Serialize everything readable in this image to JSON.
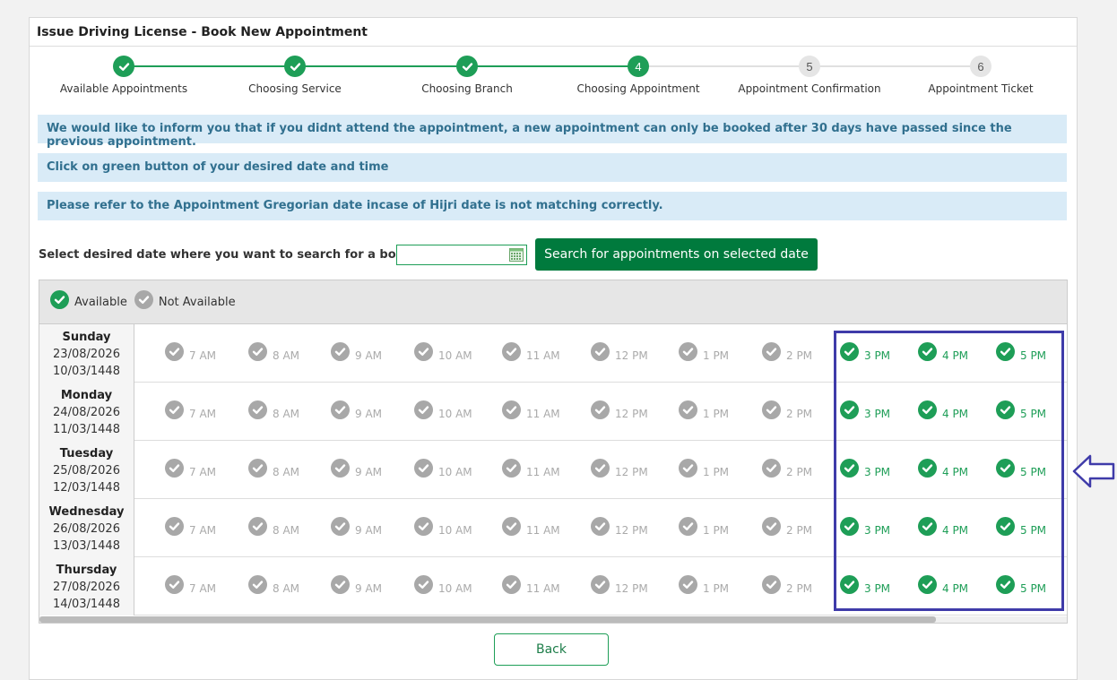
{
  "panel": {
    "title": "Issue Driving License - Book New Appointment"
  },
  "steps": [
    {
      "number": "1",
      "label": "Available Appointments",
      "state": "done"
    },
    {
      "number": "2",
      "label": "Choosing Service",
      "state": "done"
    },
    {
      "number": "3",
      "label": "Choosing Branch",
      "state": "done"
    },
    {
      "number": "4",
      "label": "Choosing Appointment",
      "state": "current"
    },
    {
      "number": "5",
      "label": "Appointment Confirmation",
      "state": "todo"
    },
    {
      "number": "6",
      "label": "Appointment Ticket",
      "state": "todo"
    }
  ],
  "notices": [
    "We would like to inform you that if you didnt attend the appointment, a new appointment can only be booked after 30 days have passed since the previous appointment.",
    "Click on green button of your desired date and time",
    "Please refer to the Appointment Gregorian date incase of Hijri date is not matching correctly."
  ],
  "search": {
    "label": "Select desired date where you want to search for a booking  :",
    "date_value": "",
    "button_label": "Search for appointments on selected date"
  },
  "legend": {
    "available": "Available",
    "not_available": "Not Available"
  },
  "time_slots": [
    "7 AM",
    "8 AM",
    "9 AM",
    "10 AM",
    "11 AM",
    "12 PM",
    "1 PM",
    "2 PM",
    "3 PM",
    "4 PM",
    "5 PM"
  ],
  "days": [
    {
      "name": "Sunday",
      "gregorian": "23/08/2026",
      "hijri": "10/03/1448",
      "available": [
        false,
        false,
        false,
        false,
        false,
        false,
        false,
        false,
        true,
        true,
        true
      ]
    },
    {
      "name": "Monday",
      "gregorian": "24/08/2026",
      "hijri": "11/03/1448",
      "available": [
        false,
        false,
        false,
        false,
        false,
        false,
        false,
        false,
        true,
        true,
        true
      ]
    },
    {
      "name": "Tuesday",
      "gregorian": "25/08/2026",
      "hijri": "12/03/1448",
      "available": [
        false,
        false,
        false,
        false,
        false,
        false,
        false,
        false,
        true,
        true,
        true
      ]
    },
    {
      "name": "Wednesday",
      "gregorian": "26/08/2026",
      "hijri": "13/03/1448",
      "available": [
        false,
        false,
        false,
        false,
        false,
        false,
        false,
        false,
        true,
        true,
        true
      ]
    },
    {
      "name": "Thursday",
      "gregorian": "27/08/2026",
      "hijri": "14/03/1448",
      "available": [
        false,
        false,
        false,
        false,
        false,
        false,
        false,
        false,
        true,
        true,
        true
      ]
    }
  ],
  "back_label": "Back",
  "colors": {
    "accent_green": "#1e9e57",
    "button_green": "#007a3d",
    "notice_bg": "#d9ebf7",
    "notice_text": "#31708f",
    "highlight": "#3f3ba9"
  },
  "icons": {
    "available": "check-circle-green-icon",
    "not_available": "check-circle-grey-icon",
    "calendar": "calendar-icon",
    "arrow": "left-arrow-icon"
  }
}
